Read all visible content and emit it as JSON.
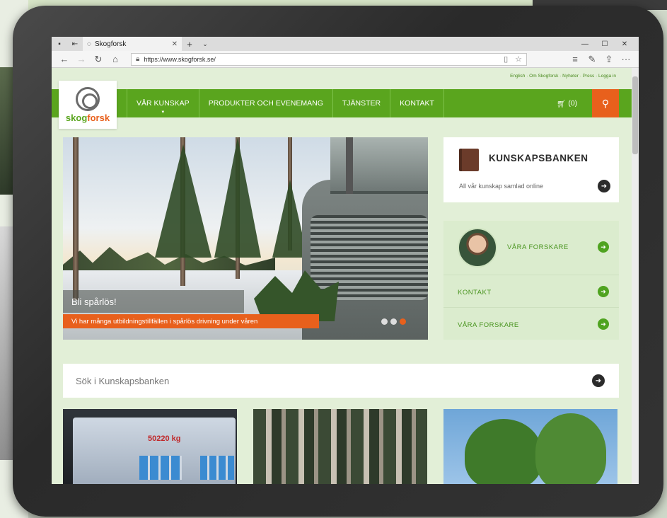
{
  "browser": {
    "tab_title": "Skogforsk",
    "url": "https://www.skogforsk.se/"
  },
  "site": {
    "top_links": "English · Om Skogforsk · Nyheter · Press · Logga in",
    "logo_text_a": "skog",
    "logo_text_b": "forsk",
    "menu": [
      {
        "label": "VÅR KUNSKAP"
      },
      {
        "label": "PRODUKTER OCH EVENEMANG"
      },
      {
        "label": "TJÄNSTER"
      },
      {
        "label": "KONTAKT"
      }
    ],
    "cart_label": "(0)",
    "hero": {
      "title": "Bli spårlös!",
      "subtitle": "Vi har många utbildningstillfällen i spårlös drivning under våren"
    },
    "kunskapsbanken": {
      "title": "KUNSKAPSBANKEN",
      "text": "All vår kunskap samlad online"
    },
    "researchers": {
      "featured_label": "VÅRA FORSKARE",
      "links": [
        {
          "label": "KONTAKT"
        },
        {
          "label": "VÅRA FORSKARE"
        }
      ]
    },
    "search": {
      "placeholder": "Sök i Kunskapsbanken"
    },
    "thumbnail_text": "50220 kg"
  },
  "colors": {
    "brand_green": "#5aa51e",
    "accent_orange": "#e8601c",
    "page_bg": "#e2efd7"
  }
}
